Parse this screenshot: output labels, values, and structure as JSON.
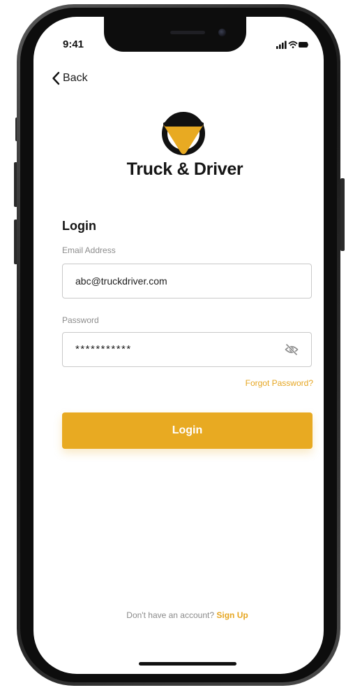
{
  "status_bar": {
    "time": "9:41",
    "icons": [
      "signal-icon",
      "wifi-icon",
      "battery-icon"
    ]
  },
  "nav": {
    "back_label": "Back",
    "back_icon": "chevron-left-icon"
  },
  "brand": {
    "name": "Truck & Driver",
    "logo_icon": "truck-driver-logo",
    "logo_colors": {
      "dark": "#111111",
      "accent": "#e8aa22"
    }
  },
  "form": {
    "heading": "Login",
    "email": {
      "label": "Email Address",
      "value": "abc@truckdriver.com"
    },
    "password": {
      "label": "Password",
      "value": "***********",
      "toggle_icon": "eye-slash-icon"
    },
    "forgot_password": "Forgot Password?",
    "submit_label": "Login"
  },
  "footer": {
    "prompt": "Don't have an account?",
    "signup_label": "Sign Up"
  },
  "colors": {
    "accent": "#e8aa22",
    "text": "#141414",
    "muted": "#8c8c8c",
    "border": "#c9c9c9"
  }
}
